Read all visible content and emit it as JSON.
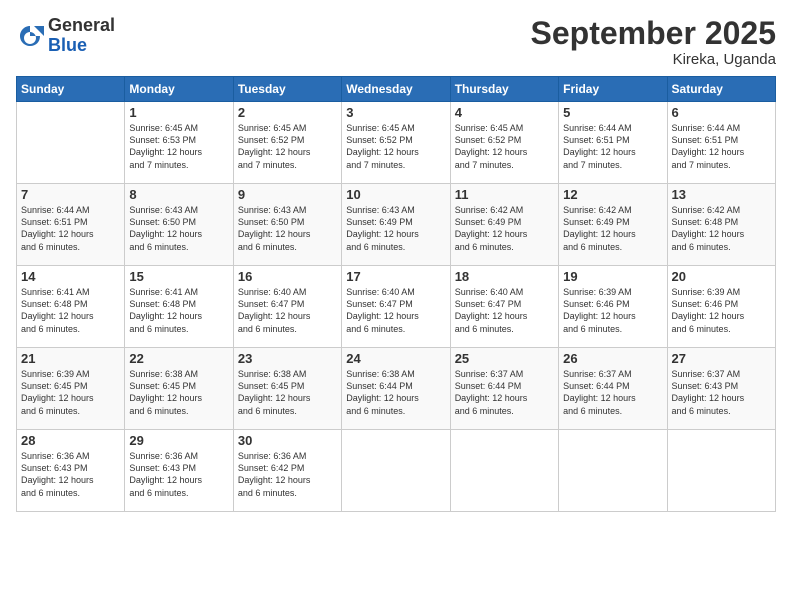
{
  "header": {
    "logo_general": "General",
    "logo_blue": "Blue",
    "month_title": "September 2025",
    "location": "Kireka, Uganda"
  },
  "days_of_week": [
    "Sunday",
    "Monday",
    "Tuesday",
    "Wednesday",
    "Thursday",
    "Friday",
    "Saturday"
  ],
  "weeks": [
    [
      {
        "day": "",
        "info": ""
      },
      {
        "day": "1",
        "info": "Sunrise: 6:45 AM\nSunset: 6:53 PM\nDaylight: 12 hours\nand 7 minutes."
      },
      {
        "day": "2",
        "info": "Sunrise: 6:45 AM\nSunset: 6:52 PM\nDaylight: 12 hours\nand 7 minutes."
      },
      {
        "day": "3",
        "info": "Sunrise: 6:45 AM\nSunset: 6:52 PM\nDaylight: 12 hours\nand 7 minutes."
      },
      {
        "day": "4",
        "info": "Sunrise: 6:45 AM\nSunset: 6:52 PM\nDaylight: 12 hours\nand 7 minutes."
      },
      {
        "day": "5",
        "info": "Sunrise: 6:44 AM\nSunset: 6:51 PM\nDaylight: 12 hours\nand 7 minutes."
      },
      {
        "day": "6",
        "info": "Sunrise: 6:44 AM\nSunset: 6:51 PM\nDaylight: 12 hours\nand 7 minutes."
      }
    ],
    [
      {
        "day": "7",
        "info": "Sunrise: 6:44 AM\nSunset: 6:51 PM\nDaylight: 12 hours\nand 6 minutes."
      },
      {
        "day": "8",
        "info": "Sunrise: 6:43 AM\nSunset: 6:50 PM\nDaylight: 12 hours\nand 6 minutes."
      },
      {
        "day": "9",
        "info": "Sunrise: 6:43 AM\nSunset: 6:50 PM\nDaylight: 12 hours\nand 6 minutes."
      },
      {
        "day": "10",
        "info": "Sunrise: 6:43 AM\nSunset: 6:49 PM\nDaylight: 12 hours\nand 6 minutes."
      },
      {
        "day": "11",
        "info": "Sunrise: 6:42 AM\nSunset: 6:49 PM\nDaylight: 12 hours\nand 6 minutes."
      },
      {
        "day": "12",
        "info": "Sunrise: 6:42 AM\nSunset: 6:49 PM\nDaylight: 12 hours\nand 6 minutes."
      },
      {
        "day": "13",
        "info": "Sunrise: 6:42 AM\nSunset: 6:48 PM\nDaylight: 12 hours\nand 6 minutes."
      }
    ],
    [
      {
        "day": "14",
        "info": "Sunrise: 6:41 AM\nSunset: 6:48 PM\nDaylight: 12 hours\nand 6 minutes."
      },
      {
        "day": "15",
        "info": "Sunrise: 6:41 AM\nSunset: 6:48 PM\nDaylight: 12 hours\nand 6 minutes."
      },
      {
        "day": "16",
        "info": "Sunrise: 6:40 AM\nSunset: 6:47 PM\nDaylight: 12 hours\nand 6 minutes."
      },
      {
        "day": "17",
        "info": "Sunrise: 6:40 AM\nSunset: 6:47 PM\nDaylight: 12 hours\nand 6 minutes."
      },
      {
        "day": "18",
        "info": "Sunrise: 6:40 AM\nSunset: 6:47 PM\nDaylight: 12 hours\nand 6 minutes."
      },
      {
        "day": "19",
        "info": "Sunrise: 6:39 AM\nSunset: 6:46 PM\nDaylight: 12 hours\nand 6 minutes."
      },
      {
        "day": "20",
        "info": "Sunrise: 6:39 AM\nSunset: 6:46 PM\nDaylight: 12 hours\nand 6 minutes."
      }
    ],
    [
      {
        "day": "21",
        "info": "Sunrise: 6:39 AM\nSunset: 6:45 PM\nDaylight: 12 hours\nand 6 minutes."
      },
      {
        "day": "22",
        "info": "Sunrise: 6:38 AM\nSunset: 6:45 PM\nDaylight: 12 hours\nand 6 minutes."
      },
      {
        "day": "23",
        "info": "Sunrise: 6:38 AM\nSunset: 6:45 PM\nDaylight: 12 hours\nand 6 minutes."
      },
      {
        "day": "24",
        "info": "Sunrise: 6:38 AM\nSunset: 6:44 PM\nDaylight: 12 hours\nand 6 minutes."
      },
      {
        "day": "25",
        "info": "Sunrise: 6:37 AM\nSunset: 6:44 PM\nDaylight: 12 hours\nand 6 minutes."
      },
      {
        "day": "26",
        "info": "Sunrise: 6:37 AM\nSunset: 6:44 PM\nDaylight: 12 hours\nand 6 minutes."
      },
      {
        "day": "27",
        "info": "Sunrise: 6:37 AM\nSunset: 6:43 PM\nDaylight: 12 hours\nand 6 minutes."
      }
    ],
    [
      {
        "day": "28",
        "info": "Sunrise: 6:36 AM\nSunset: 6:43 PM\nDaylight: 12 hours\nand 6 minutes."
      },
      {
        "day": "29",
        "info": "Sunrise: 6:36 AM\nSunset: 6:43 PM\nDaylight: 12 hours\nand 6 minutes."
      },
      {
        "day": "30",
        "info": "Sunrise: 6:36 AM\nSunset: 6:42 PM\nDaylight: 12 hours\nand 6 minutes."
      },
      {
        "day": "",
        "info": ""
      },
      {
        "day": "",
        "info": ""
      },
      {
        "day": "",
        "info": ""
      },
      {
        "day": "",
        "info": ""
      }
    ]
  ]
}
